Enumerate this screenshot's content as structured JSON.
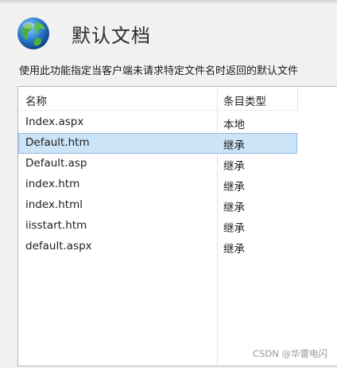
{
  "header": {
    "title": "默认文档",
    "icon": "globe-icon"
  },
  "description": "使用此功能指定当客户端未请求特定文件名时返回的默认文件",
  "table": {
    "columns": [
      "名称",
      "条目类型"
    ],
    "rows": [
      {
        "name": "Index.aspx",
        "type": "本地",
        "selected": false
      },
      {
        "name": "Default.htm",
        "type": "继承",
        "selected": true
      },
      {
        "name": "Default.asp",
        "type": "继承",
        "selected": false
      },
      {
        "name": "index.htm",
        "type": "继承",
        "selected": false
      },
      {
        "name": "index.html",
        "type": "继承",
        "selected": false
      },
      {
        "name": "iisstart.htm",
        "type": "继承",
        "selected": false
      },
      {
        "name": "default.aspx",
        "type": "继承",
        "selected": false
      }
    ]
  },
  "watermark": "CSDN @华雷电闪",
  "colors": {
    "selection": "#cce4f7",
    "panel_border": "#b9b9b9"
  }
}
